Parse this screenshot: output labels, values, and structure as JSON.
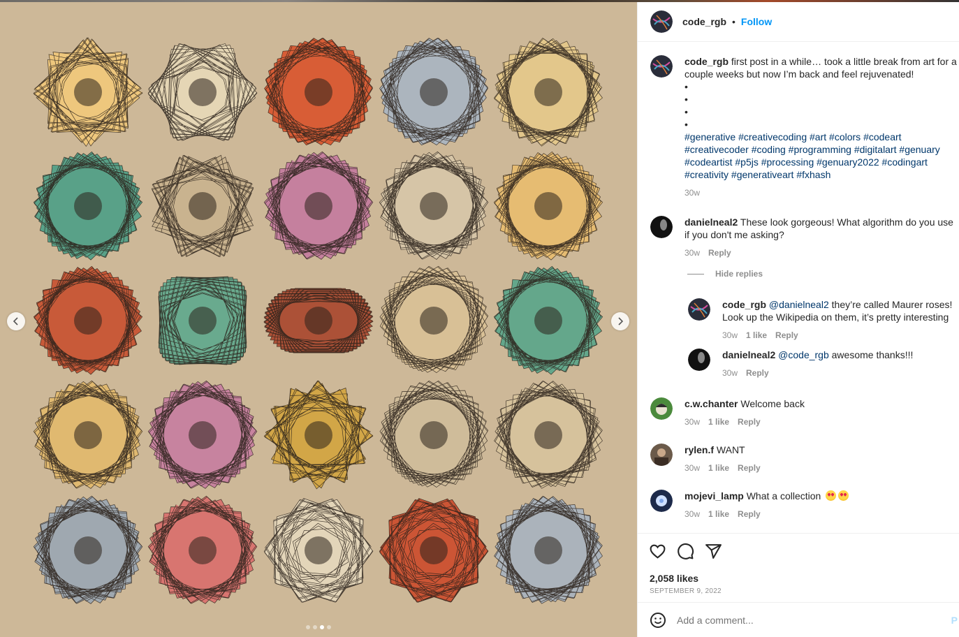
{
  "post": {
    "username": "code_rgb",
    "separator": "•",
    "follow_label": "Follow",
    "caption": "first post in a while… took a little break from art for a couple weeks but now I’m back and feel rejuvenated!",
    "bullets": [
      "•",
      "•",
      "•",
      "•"
    ],
    "hashtags": [
      "#generative",
      "#creativecoding",
      "#art",
      "#colors",
      "#codeart",
      "#creativecoder",
      "#coding",
      "#programming",
      "#digitalart",
      "#genuary",
      "#codeartist",
      "#p5js",
      "#processing",
      "#genuary2022",
      "#codingart",
      "#creativity",
      "#generativeart",
      "#fxhash"
    ],
    "caption_time": "30w",
    "likes": "2,058 likes",
    "date": "SEPTEMBER 9, 2022",
    "add_comment_placeholder": "Add a comment...",
    "post_label": "P"
  },
  "comments": [
    {
      "user": "danielneal2",
      "text": "These look gorgeous! What algorithm do you use if you don't me asking?",
      "time": "30w",
      "reply": "Reply"
    },
    {
      "user": "c.w.chanter",
      "text": "Welcome back",
      "time": "30w",
      "likes": "1 like",
      "reply": "Reply"
    },
    {
      "user": "rylen.f",
      "text": "WANT",
      "time": "30w",
      "likes": "1 like",
      "reply": "Reply"
    },
    {
      "user": "mojevi_lamp",
      "text": "What a collection",
      "time": "30w",
      "likes": "1 like",
      "reply": "Reply"
    }
  ],
  "hide_replies": "Hide replies",
  "replies": [
    {
      "user": "code_rgb",
      "mention": "@danielneal2",
      "text": "they’re called Maurer roses! Look up the Wikipedia on them, it’s pretty interesting",
      "time": "30w",
      "likes": "1 like",
      "reply": "Reply"
    },
    {
      "user": "danielneal2",
      "mention": "@code_rgb",
      "text": "awesome thanks!!!",
      "time": "30w",
      "reply": "Reply"
    }
  ],
  "carousel": {
    "count": 4,
    "active_index": 2
  },
  "flowers": [
    {
      "fill": "#f2c97a",
      "k": 8,
      "shape": "star"
    },
    {
      "fill": "#e8d9b8",
      "k": 6,
      "shape": "star"
    },
    {
      "fill": "#d9532b",
      "k": 20,
      "shape": "round"
    },
    {
      "fill": "#a9b5c2",
      "k": 20,
      "shape": "round"
    },
    {
      "fill": "#e6c98a",
      "k": 14,
      "shape": "round"
    },
    {
      "fill": "#4d9e86",
      "k": 24,
      "shape": "round"
    },
    {
      "fill": "#c9b28e",
      "k": 4,
      "shape": "lobe"
    },
    {
      "fill": "#c47a9e",
      "k": 22,
      "shape": "round"
    },
    {
      "fill": "#d7c6a8",
      "k": 22,
      "shape": "round"
    },
    {
      "fill": "#e9bd6e",
      "k": 24,
      "shape": "round"
    },
    {
      "fill": "#c8502f",
      "k": 24,
      "shape": "round"
    },
    {
      "fill": "#5ea88d",
      "k": 2,
      "shape": "lobe"
    },
    {
      "fill": "#a8462c",
      "k": 2,
      "shape": "bow"
    },
    {
      "fill": "#d9c196",
      "k": 18,
      "shape": "round"
    },
    {
      "fill": "#59a58a",
      "k": 24,
      "shape": "round"
    },
    {
      "fill": "#e2b96c",
      "k": 22,
      "shape": "round"
    },
    {
      "fill": "#c77da0",
      "k": 22,
      "shape": "round"
    },
    {
      "fill": "#d3a43e",
      "k": 12,
      "shape": "star"
    },
    {
      "fill": "#cfbd9a",
      "k": 18,
      "shape": "round"
    },
    {
      "fill": "#d7c39c",
      "k": 16,
      "shape": "round"
    },
    {
      "fill": "#9aa6b3",
      "k": 22,
      "shape": "round"
    },
    {
      "fill": "#d96e6c",
      "k": 22,
      "shape": "round"
    },
    {
      "fill": "#e5d8bc",
      "k": 10,
      "shape": "star"
    },
    {
      "fill": "#cc4a2a",
      "k": 10,
      "shape": "star"
    },
    {
      "fill": "#a7b3bf",
      "k": 16,
      "shape": "round"
    }
  ]
}
